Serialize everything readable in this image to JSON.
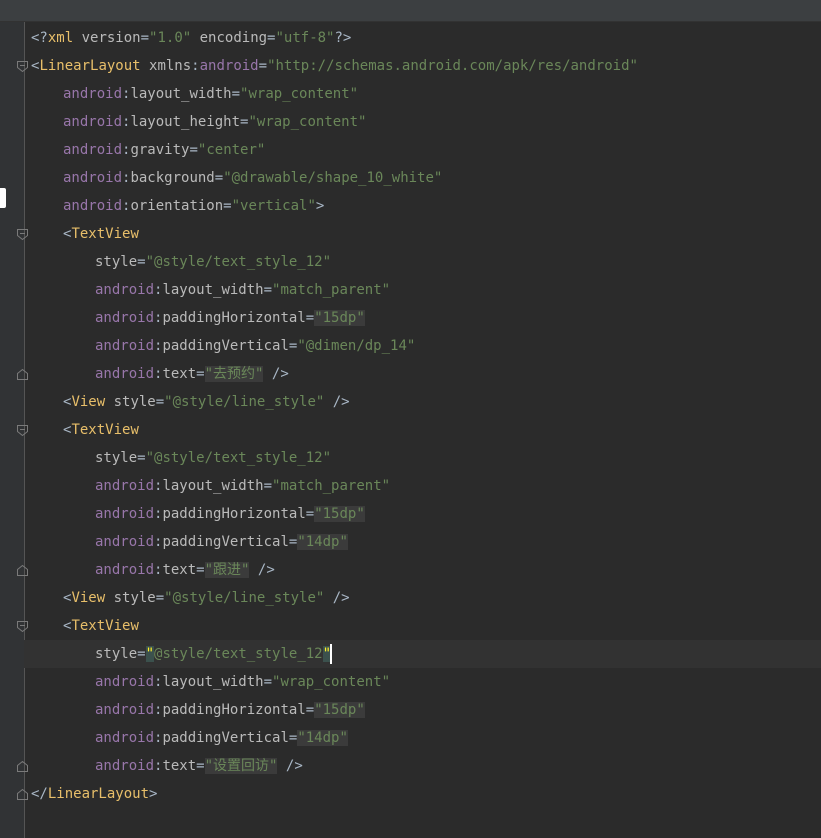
{
  "editor": {
    "lines": [
      {
        "indent": 0,
        "tokens": [
          [
            "punct",
            "<?"
          ],
          [
            "tag",
            "xml"
          ],
          [
            "attr",
            " version"
          ],
          [
            "punct",
            "="
          ],
          [
            "val",
            "\"1.0\""
          ],
          [
            "attr",
            " encoding"
          ],
          [
            "punct",
            "="
          ],
          [
            "val",
            "\"utf-8\""
          ],
          [
            "punct",
            "?>"
          ]
        ]
      },
      {
        "indent": 0,
        "fold": "open",
        "tokens": [
          [
            "punct",
            "<"
          ],
          [
            "tag",
            "LinearLayout"
          ],
          [
            "attr",
            " xmlns"
          ],
          [
            "punct",
            ":"
          ],
          [
            "ns",
            "android"
          ],
          [
            "punct",
            "="
          ],
          [
            "val",
            "\"http://schemas.android.com/apk/res/android\""
          ]
        ]
      },
      {
        "indent": 1,
        "tokens": [
          [
            "ns",
            "android"
          ],
          [
            "punct",
            ":"
          ],
          [
            "attr",
            "layout_width"
          ],
          [
            "punct",
            "="
          ],
          [
            "val",
            "\"wrap_content\""
          ]
        ]
      },
      {
        "indent": 1,
        "tokens": [
          [
            "ns",
            "android"
          ],
          [
            "punct",
            ":"
          ],
          [
            "attr",
            "layout_height"
          ],
          [
            "punct",
            "="
          ],
          [
            "val",
            "\"wrap_content\""
          ]
        ]
      },
      {
        "indent": 1,
        "tokens": [
          [
            "ns",
            "android"
          ],
          [
            "punct",
            ":"
          ],
          [
            "attr",
            "gravity"
          ],
          [
            "punct",
            "="
          ],
          [
            "val",
            "\"center\""
          ]
        ]
      },
      {
        "indent": 1,
        "tokens": [
          [
            "ns",
            "android"
          ],
          [
            "punct",
            ":"
          ],
          [
            "attr",
            "background"
          ],
          [
            "punct",
            "="
          ],
          [
            "val",
            "\"@drawable/shape_10_white\""
          ]
        ]
      },
      {
        "indent": 1,
        "tokens": [
          [
            "ns",
            "android"
          ],
          [
            "punct",
            ":"
          ],
          [
            "attr",
            "orientation"
          ],
          [
            "punct",
            "="
          ],
          [
            "val",
            "\"vertical\""
          ],
          [
            "punct",
            ">"
          ]
        ]
      },
      {
        "indent": 1,
        "fold": "open",
        "tokens": [
          [
            "punct",
            "<"
          ],
          [
            "tag",
            "TextView"
          ]
        ]
      },
      {
        "indent": 2,
        "tokens": [
          [
            "attr",
            "style"
          ],
          [
            "punct",
            "="
          ],
          [
            "val",
            "\"@style/text_style_12\""
          ]
        ]
      },
      {
        "indent": 2,
        "tokens": [
          [
            "ns",
            "android"
          ],
          [
            "punct",
            ":"
          ],
          [
            "attr",
            "layout_width"
          ],
          [
            "punct",
            "="
          ],
          [
            "val",
            "\"match_parent\""
          ]
        ]
      },
      {
        "indent": 2,
        "tokens": [
          [
            "ns",
            "android"
          ],
          [
            "punct",
            ":"
          ],
          [
            "attr",
            "paddingHorizontal"
          ],
          [
            "punct",
            "="
          ],
          [
            "valhl",
            "\"15dp\""
          ]
        ]
      },
      {
        "indent": 2,
        "tokens": [
          [
            "ns",
            "android"
          ],
          [
            "punct",
            ":"
          ],
          [
            "attr",
            "paddingVertical"
          ],
          [
            "punct",
            "="
          ],
          [
            "val",
            "\"@dimen/dp_14\""
          ]
        ]
      },
      {
        "indent": 2,
        "fold": "close",
        "tokens": [
          [
            "ns",
            "android"
          ],
          [
            "punct",
            ":"
          ],
          [
            "attr",
            "text"
          ],
          [
            "punct",
            "="
          ],
          [
            "valhl",
            "\"去预约\""
          ],
          [
            "punct",
            " />"
          ]
        ]
      },
      {
        "indent": 1,
        "tokens": [
          [
            "punct",
            "<"
          ],
          [
            "tag",
            "View"
          ],
          [
            "attr",
            " style"
          ],
          [
            "punct",
            "="
          ],
          [
            "val",
            "\"@style/line_style\""
          ],
          [
            "punct",
            " />"
          ]
        ]
      },
      {
        "indent": 1,
        "fold": "open",
        "tokens": [
          [
            "punct",
            "<"
          ],
          [
            "tag",
            "TextView"
          ]
        ]
      },
      {
        "indent": 2,
        "tokens": [
          [
            "attr",
            "style"
          ],
          [
            "punct",
            "="
          ],
          [
            "val",
            "\"@style/text_style_12\""
          ]
        ]
      },
      {
        "indent": 2,
        "tokens": [
          [
            "ns",
            "android"
          ],
          [
            "punct",
            ":"
          ],
          [
            "attr",
            "layout_width"
          ],
          [
            "punct",
            "="
          ],
          [
            "val",
            "\"match_parent\""
          ]
        ]
      },
      {
        "indent": 2,
        "tokens": [
          [
            "ns",
            "android"
          ],
          [
            "punct",
            ":"
          ],
          [
            "attr",
            "paddingHorizontal"
          ],
          [
            "punct",
            "="
          ],
          [
            "valhl",
            "\"15dp\""
          ]
        ]
      },
      {
        "indent": 2,
        "tokens": [
          [
            "ns",
            "android"
          ],
          [
            "punct",
            ":"
          ],
          [
            "attr",
            "paddingVertical"
          ],
          [
            "punct",
            "="
          ],
          [
            "valhl",
            "\"14dp\""
          ]
        ]
      },
      {
        "indent": 2,
        "fold": "close",
        "tokens": [
          [
            "ns",
            "android"
          ],
          [
            "punct",
            ":"
          ],
          [
            "attr",
            "text"
          ],
          [
            "punct",
            "="
          ],
          [
            "valhl",
            "\"跟进\""
          ],
          [
            "punct",
            " />"
          ]
        ]
      },
      {
        "indent": 1,
        "tokens": [
          [
            "punct",
            "<"
          ],
          [
            "tag",
            "View"
          ],
          [
            "attr",
            " style"
          ],
          [
            "punct",
            "="
          ],
          [
            "val",
            "\"@style/line_style\""
          ],
          [
            "punct",
            " />"
          ]
        ]
      },
      {
        "indent": 1,
        "fold": "open",
        "tokens": [
          [
            "punct",
            "<"
          ],
          [
            "tag",
            "TextView"
          ]
        ]
      },
      {
        "indent": 2,
        "current": true,
        "tokens": [
          [
            "attr",
            "style"
          ],
          [
            "punct",
            "="
          ],
          [
            "matchq",
            "\""
          ],
          [
            "val",
            "@style/text_style_12"
          ],
          [
            "matchq",
            "\""
          ],
          [
            "caret",
            ""
          ]
        ]
      },
      {
        "indent": 2,
        "tokens": [
          [
            "ns",
            "android"
          ],
          [
            "punct",
            ":"
          ],
          [
            "attr",
            "layout_width"
          ],
          [
            "punct",
            "="
          ],
          [
            "val",
            "\"wrap_content\""
          ]
        ]
      },
      {
        "indent": 2,
        "tokens": [
          [
            "ns",
            "android"
          ],
          [
            "punct",
            ":"
          ],
          [
            "attr",
            "paddingHorizontal"
          ],
          [
            "punct",
            "="
          ],
          [
            "valhl",
            "\"15dp\""
          ]
        ]
      },
      {
        "indent": 2,
        "tokens": [
          [
            "ns",
            "android"
          ],
          [
            "punct",
            ":"
          ],
          [
            "attr",
            "paddingVertical"
          ],
          [
            "punct",
            "="
          ],
          [
            "valhl",
            "\"14dp\""
          ]
        ]
      },
      {
        "indent": 2,
        "fold": "close",
        "tokens": [
          [
            "ns",
            "android"
          ],
          [
            "punct",
            ":"
          ],
          [
            "attr",
            "text"
          ],
          [
            "punct",
            "="
          ],
          [
            "valhl",
            "\"设置回访\""
          ],
          [
            "punct",
            " />"
          ]
        ]
      },
      {
        "indent": 0,
        "fold": "close",
        "tokens": [
          [
            "punct",
            "</"
          ],
          [
            "tag",
            "LinearLayout"
          ],
          [
            "punct",
            ">"
          ]
        ]
      }
    ]
  },
  "colors": {
    "background": "#2b2b2b",
    "tag": "#e8bf6a",
    "namespace": "#9876aa",
    "attribute": "#bababa",
    "value": "#6a8759"
  },
  "icons": {
    "fold_open": "fold-open-icon",
    "fold_close": "fold-close-icon"
  }
}
